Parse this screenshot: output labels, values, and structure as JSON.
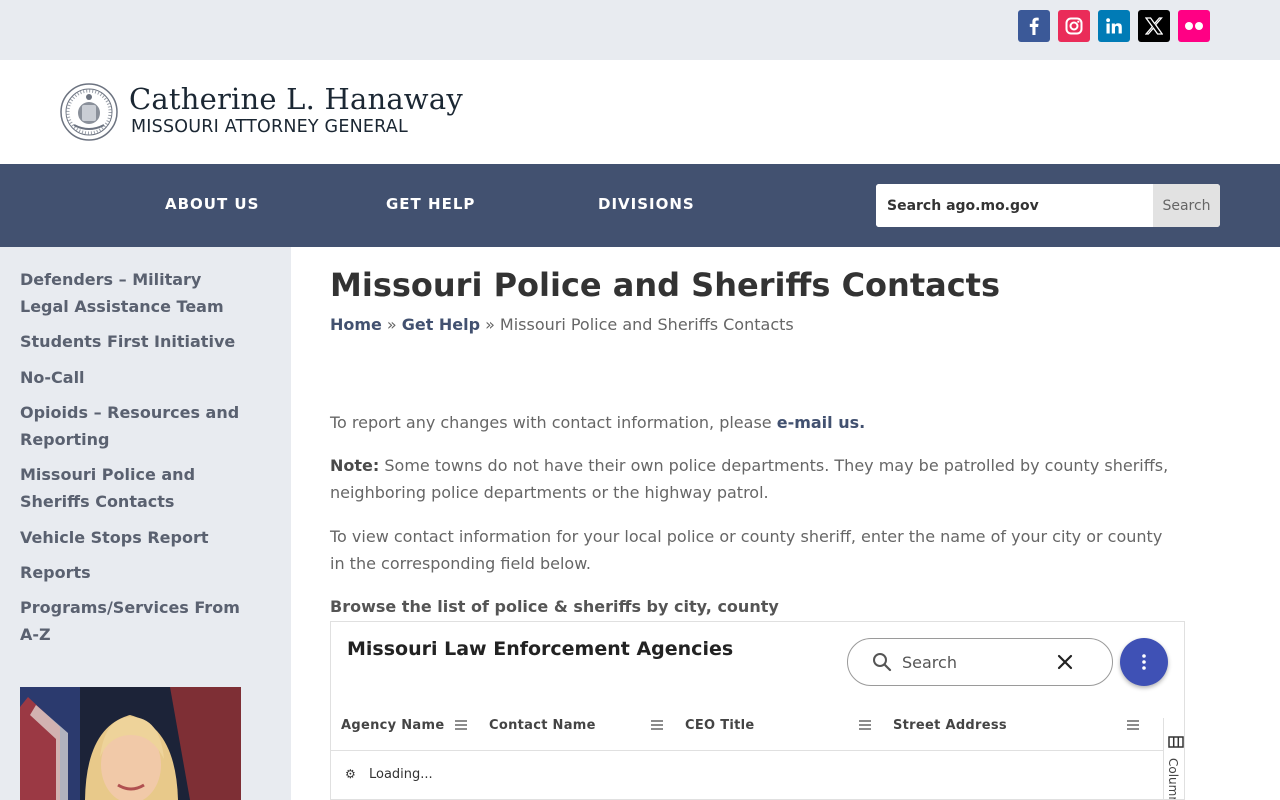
{
  "social": [
    {
      "name": "facebook",
      "color": "#3b5998",
      "icon": "facebook-icon"
    },
    {
      "name": "instagram",
      "color": "#ea2c59",
      "icon": "instagram-icon"
    },
    {
      "name": "linkedin",
      "color": "#007bb6",
      "icon": "linkedin-icon"
    },
    {
      "name": "x",
      "color": "#000000",
      "icon": "x-icon"
    },
    {
      "name": "flickr",
      "color": "#ff0084",
      "icon": "flickr-icon"
    }
  ],
  "brand": {
    "name": "Catherine L. Hanaway",
    "subtitle": "MISSOURI ATTORNEY GENERAL"
  },
  "nav": {
    "items": [
      "ABOUT US",
      "GET HELP",
      "DIVISIONS"
    ],
    "search_placeholder": "Search ago.mo.gov",
    "search_button": "Search",
    "bg_color": "#425170"
  },
  "sidebar": {
    "items": [
      "Defenders – Military Legal Assistance Team",
      "Students First Initiative",
      "No-Call",
      "Opioids – Resources and Reporting",
      "Missouri Police and Sheriffs Contacts",
      "Vehicle Stops Report",
      "Reports",
      "Programs/Services From A-Z"
    ]
  },
  "page": {
    "title": "Missouri Police and Sheriffs Contacts",
    "breadcrumb": {
      "home": "Home",
      "sep": "»",
      "parent": "Get Help",
      "current": "Missouri Police and Sheriffs Contacts"
    },
    "p1_text": "To report any changes with contact information, please ",
    "p1_link": "e-mail us.",
    "p2_label": "Note:",
    "p2_text": " Some towns do not have their own police departments. They may be patrolled by county sheriffs, neighboring police departments or the highway patrol.",
    "p3_text": "To view contact information for your local police or county sheriff, enter the name of your city or county in the corresponding field below.",
    "browse": "Browse the list of police & sheriffs by city, county"
  },
  "widget": {
    "title": "Missouri Law Enforcement Agencies",
    "search_placeholder": "Search",
    "columns": [
      "Agency Name",
      "Contact Name",
      "CEO Title",
      "Street Address"
    ],
    "rail_label": "Columns",
    "loading": "Loading...",
    "accent": "#3f51b5"
  }
}
